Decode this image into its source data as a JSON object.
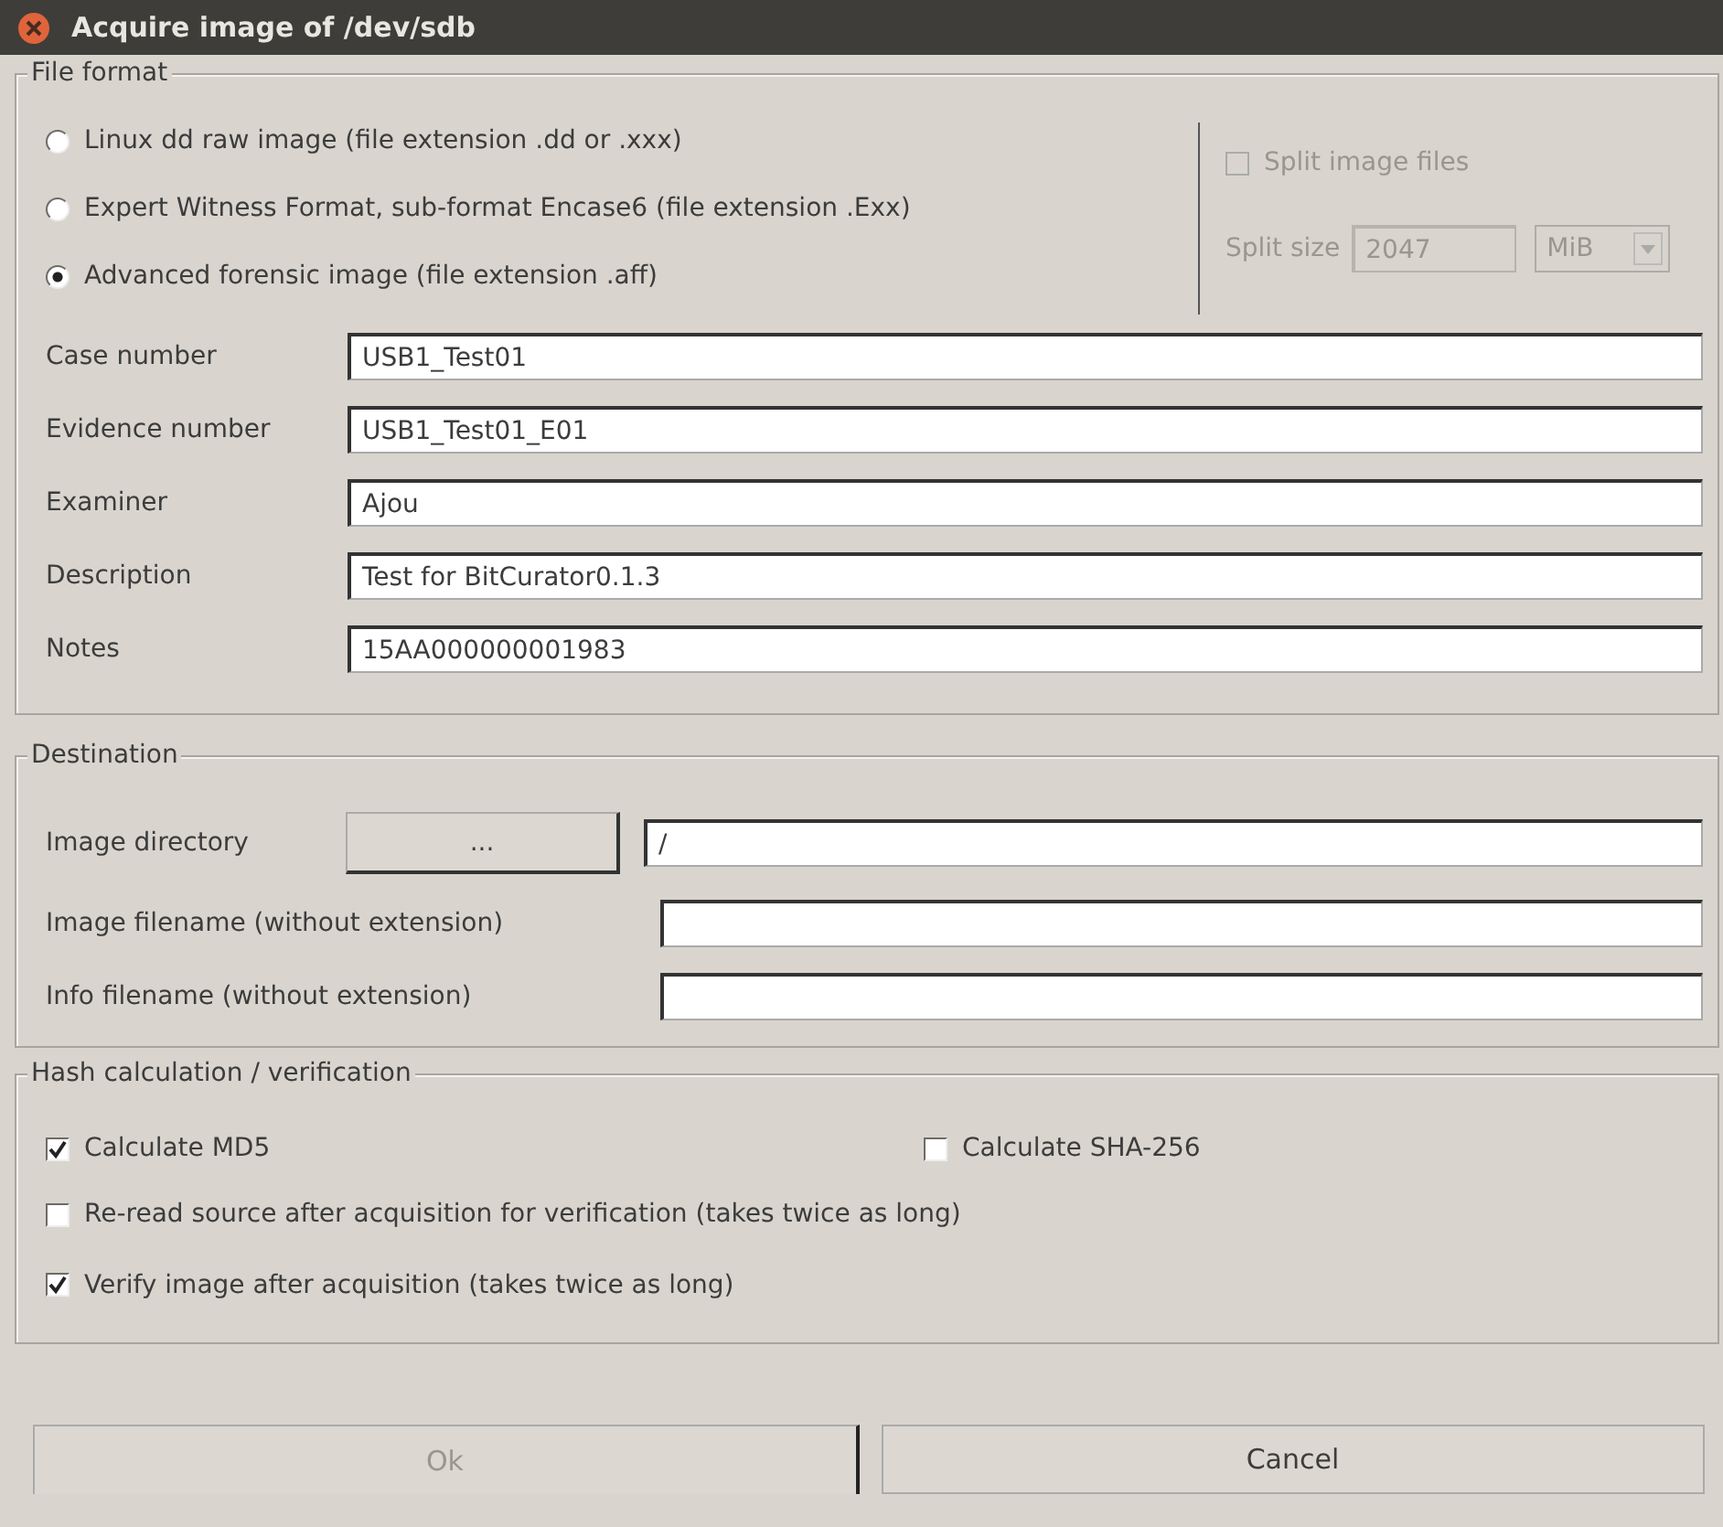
{
  "window": {
    "title": "Acquire image of /dev/sdb"
  },
  "file_format": {
    "title": "File format",
    "formats": [
      {
        "label": "Linux dd raw image (file extension .dd or .xxx)",
        "selected": false
      },
      {
        "label": "Expert Witness Format, sub-format Encase6 (file extension .Exx)",
        "selected": false
      },
      {
        "label": "Advanced forensic image (file extension .aff)",
        "selected": true
      }
    ],
    "split": {
      "label": "Split image files",
      "checked": false,
      "disabled": true,
      "size_label": "Split size",
      "size_value": "2047",
      "unit": "MiB"
    },
    "fields": [
      {
        "label": "Case number",
        "value": "USB1_Test01"
      },
      {
        "label": "Evidence number",
        "value": "USB1_Test01_E01"
      },
      {
        "label": "Examiner",
        "value": "Ajou"
      },
      {
        "label": "Description",
        "value": "Test for BitCurator0.1.3"
      },
      {
        "label": "Notes",
        "value": "15AA000000001983"
      }
    ]
  },
  "destination": {
    "title": "Destination",
    "directory": {
      "label": "Image directory",
      "button": "...",
      "value": "/"
    },
    "fields": [
      {
        "label": "Image filename (without extension)"
      },
      {
        "label": "Info filename (without extension)"
      }
    ]
  },
  "hash": {
    "title": "Hash calculation / verification",
    "rows": [
      [
        {
          "label": "Calculate MD5",
          "checked": true
        },
        {
          "label": "Calculate SHA-256",
          "checked": false
        }
      ],
      [
        {
          "label": "Re-read source after acquisition for verification (takes twice as long)",
          "checked": false
        }
      ],
      [
        {
          "label": "Verify image after acquisition (takes twice as long)",
          "checked": true
        }
      ]
    ]
  },
  "buttons": [
    {
      "label": "Ok",
      "disabled": true
    },
    {
      "label": "Cancel",
      "disabled": false
    }
  ]
}
